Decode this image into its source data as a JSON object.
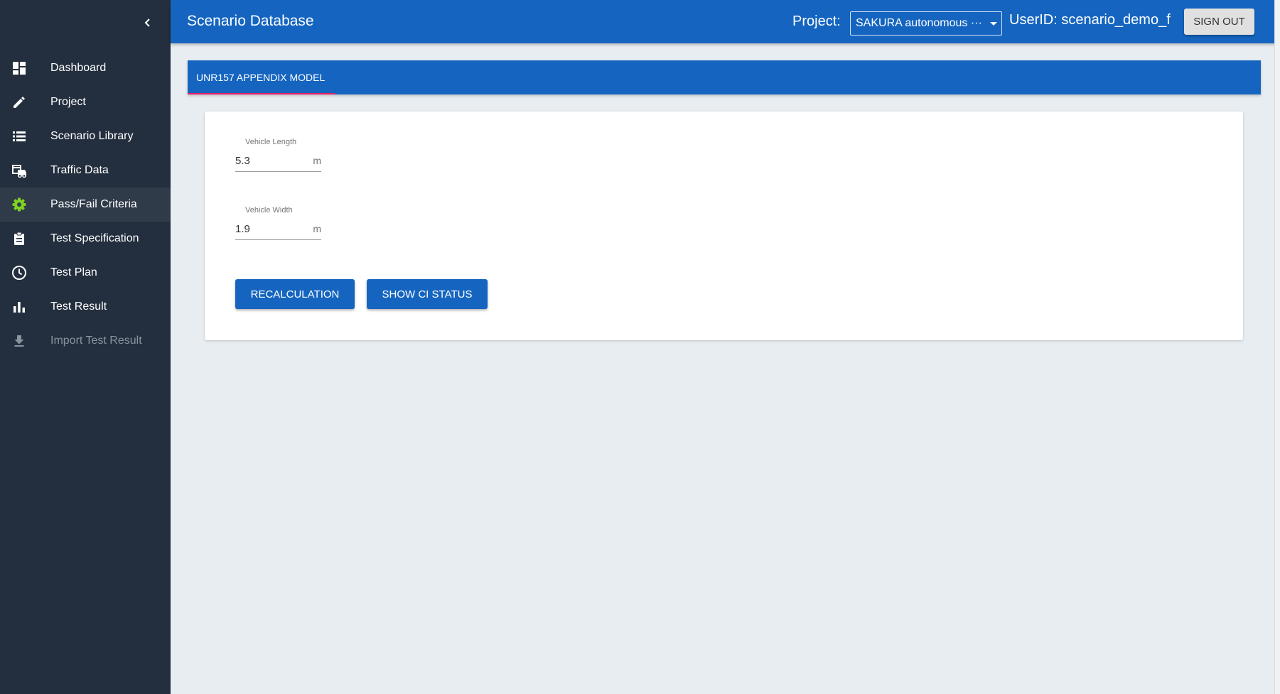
{
  "app": {
    "title": "Scenario Database"
  },
  "header": {
    "project_label": "Project:",
    "project_value": "SAKURA autonomous ···",
    "user_label": "UserID: scenario_demo_f",
    "signout_label": "SIGN OUT"
  },
  "sidebar": {
    "items": [
      {
        "label": "Dashboard",
        "icon": "dashboard-icon"
      },
      {
        "label": "Project",
        "icon": "pencil-icon"
      },
      {
        "label": "Scenario Library",
        "icon": "list-icon"
      },
      {
        "label": "Traffic Data",
        "icon": "vehicle-icon"
      },
      {
        "label": "Pass/Fail Criteria",
        "icon": "gear-icon",
        "active": true
      },
      {
        "label": "Test Specification",
        "icon": "clipboard-icon"
      },
      {
        "label": "Test Plan",
        "icon": "clock-icon"
      },
      {
        "label": "Test Result",
        "icon": "bar-chart-icon"
      },
      {
        "label": "Import Test Result",
        "icon": "download-icon",
        "disabled": true
      }
    ]
  },
  "tabs": [
    {
      "label": "UNR157 APPENDIX MODEL",
      "active": true
    }
  ],
  "form": {
    "vehicle_length": {
      "label": "Vehicle Length",
      "value": "5.3",
      "unit": "m"
    },
    "vehicle_width": {
      "label": "Vehicle Width",
      "value": "1.9",
      "unit": "m"
    }
  },
  "buttons": {
    "recalculation": "RECALCULATION",
    "show_ci_status": "SHOW CI STATUS"
  },
  "colors": {
    "primary": "#1565c0",
    "sidebar": "#232f3e",
    "sidebar_active": "#2f3b49",
    "active_icon": "#7ed321",
    "tab_indicator": "#e91e63",
    "background": "#e8edf1"
  }
}
